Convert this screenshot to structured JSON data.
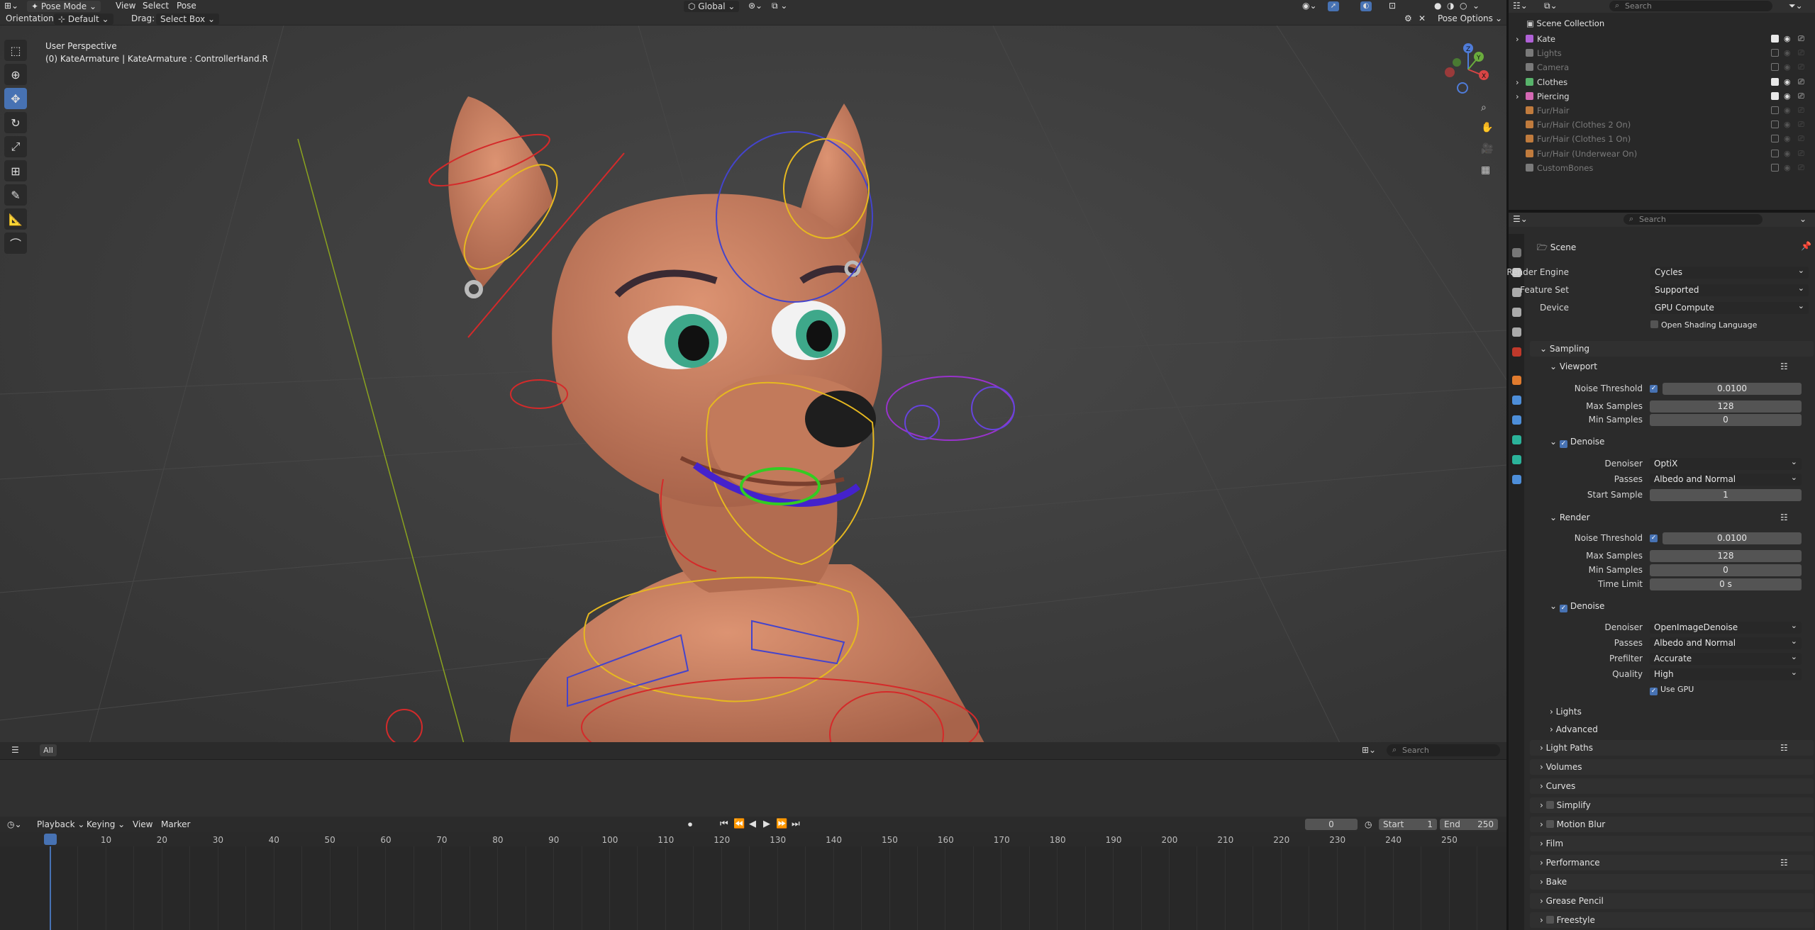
{
  "header": {
    "mode": "Pose Mode",
    "menus": [
      "View",
      "Select",
      "Pose"
    ],
    "transform_orientation": "Global",
    "search_placeholder": "Search"
  },
  "toolbar": {
    "orientation_label": "Orientation:",
    "orientation_value": "Default",
    "drag_label": "Drag:",
    "drag_value": "Select Box",
    "pose_options": "Pose Options"
  },
  "viewport": {
    "view_name": "User Perspective",
    "object_info": "(0) KateArmature | KateArmature : ControllerHand.R",
    "gizmo_axes": [
      "Z",
      "Y",
      "X"
    ]
  },
  "asset_bar": {
    "filter_label": "All",
    "search_placeholder": "Search"
  },
  "timeline": {
    "menus": [
      "Playback",
      "Keying",
      "View",
      "Marker"
    ],
    "current_frame": "0",
    "start_label": "Start",
    "start_value": "1",
    "end_label": "End",
    "end_value": "250",
    "ticks": [
      "0",
      "10",
      "20",
      "30",
      "40",
      "50",
      "60",
      "70",
      "80",
      "90",
      "100",
      "110",
      "120",
      "130",
      "140",
      "150",
      "160",
      "170",
      "180",
      "190",
      "200",
      "210",
      "220",
      "230",
      "240",
      "250"
    ]
  },
  "outliner": {
    "search_placeholder": "Search",
    "root": "Scene Collection",
    "items": [
      {
        "label": "Kate",
        "dim": false,
        "expander": true,
        "checked": true,
        "color": "#b061d6"
      },
      {
        "label": "Lights",
        "dim": true,
        "expander": false,
        "checked": false,
        "color": "#7a7a7a"
      },
      {
        "label": "Camera",
        "dim": true,
        "expander": false,
        "checked": false,
        "color": "#7a7a7a"
      },
      {
        "label": "Clothes",
        "dim": false,
        "expander": true,
        "checked": true,
        "color": "#58b36b"
      },
      {
        "label": "Piercing",
        "dim": false,
        "expander": true,
        "checked": true,
        "color": "#d468b3"
      },
      {
        "label": "Fur/Hair",
        "dim": true,
        "expander": false,
        "checked": false,
        "color": "#c07b3d"
      },
      {
        "label": "Fur/Hair (Clothes 2 On)",
        "dim": true,
        "expander": false,
        "checked": false,
        "color": "#c07b3d"
      },
      {
        "label": "Fur/Hair (Clothes 1 On)",
        "dim": true,
        "expander": false,
        "checked": false,
        "color": "#c07b3d"
      },
      {
        "label": "Fur/Hair (Underwear On)",
        "dim": true,
        "expander": false,
        "checked": false,
        "color": "#c07b3d"
      },
      {
        "label": "CustomBones",
        "dim": true,
        "expander": false,
        "checked": false,
        "color": "#7a7a7a"
      }
    ]
  },
  "properties": {
    "search_placeholder": "Search",
    "context": "Scene",
    "render_engine_label": "Render Engine",
    "render_engine": "Cycles",
    "feature_set_label": "Feature Set",
    "feature_set": "Supported",
    "device_label": "Device",
    "device": "GPU Compute",
    "osl_label": "Open Shading Language",
    "sampling": "Sampling",
    "viewport_panel": {
      "title": "Viewport",
      "noise_threshold_label": "Noise Threshold",
      "noise_threshold": "0.0100",
      "max_samples_label": "Max Samples",
      "max_samples": "128",
      "min_samples_label": "Min Samples",
      "min_samples": "0",
      "denoise": "Denoise",
      "denoiser_label": "Denoiser",
      "denoiser": "OptiX",
      "passes_label": "Passes",
      "passes": "Albedo and Normal",
      "start_sample_label": "Start Sample",
      "start_sample": "1"
    },
    "render_panel": {
      "title": "Render",
      "noise_threshold_label": "Noise Threshold",
      "noise_threshold": "0.0100",
      "max_samples_label": "Max Samples",
      "max_samples": "128",
      "min_samples_label": "Min Samples",
      "min_samples": "0",
      "time_limit_label": "Time Limit",
      "time_limit": "0 s",
      "denoise": "Denoise",
      "denoiser_label": "Denoiser",
      "denoiser": "OpenImageDenoise",
      "passes_label": "Passes",
      "passes": "Albedo and Normal",
      "prefilter_label": "Prefilter",
      "prefilter": "Accurate",
      "quality_label": "Quality",
      "quality": "High",
      "use_gpu": "Use GPU"
    },
    "sub_panels": [
      "Lights",
      "Advanced"
    ],
    "panels": [
      "Light Paths",
      "Volumes",
      "Curves",
      "Simplify",
      "Motion Blur",
      "Film",
      "Performance",
      "Bake",
      "Grease Pencil",
      "Freestyle"
    ]
  },
  "colors": {
    "accent": "#4772b3",
    "skin": "#c9805f",
    "bone_red": "#d42a2a",
    "bone_yellow": "#e6b820",
    "bone_blue": "#4444cc"
  }
}
